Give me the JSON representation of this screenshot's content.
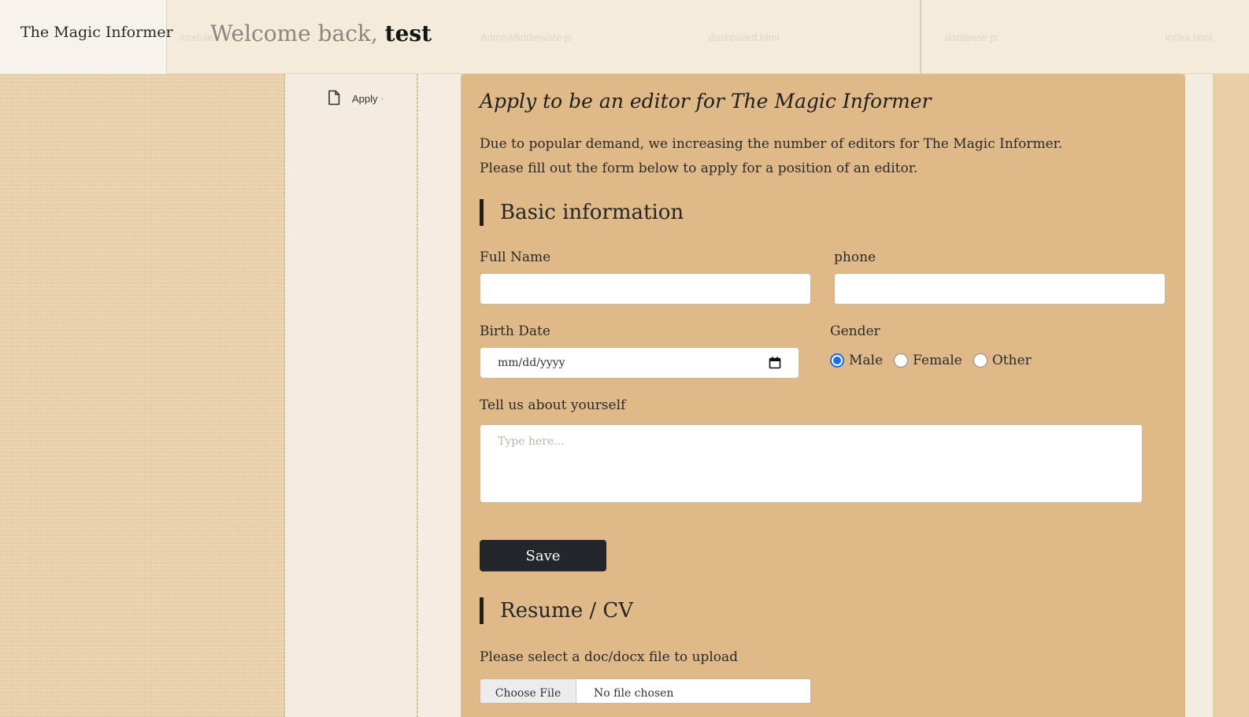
{
  "header": {
    "brand": "The Magic Informer",
    "welcome_prefix": "Welcome back,",
    "username": "test"
  },
  "sidebar": {
    "items": [
      {
        "label": "Apply",
        "icon": "document-icon"
      }
    ]
  },
  "form": {
    "title": "Apply to be an editor for The Magic Informer",
    "intro_line1": "Due to popular demand, we increasing the number of editors for The Magic Informer.",
    "intro_line2": "Please fill out the form below to apply for a position of an editor.",
    "basic_section": "Basic information",
    "full_name_label": "Full Name",
    "full_name_value": "",
    "phone_label": "phone",
    "phone_value": "",
    "birth_label": "Birth Date",
    "birth_placeholder": "mm/dd/yyyy",
    "gender_label": "Gender",
    "gender_options": [
      "Male",
      "Female",
      "Other"
    ],
    "gender_selected": "Male",
    "about_label": "Tell us about yourself",
    "about_placeholder": "Type here...",
    "save_label": "Save",
    "resume_section": "Resume / CV",
    "file_label": "Please select a doc/docx file to upload",
    "file_button": "Choose File",
    "file_status": "No file chosen"
  },
  "colors": {
    "card_bg": "#dfb988",
    "button_bg": "#23272b",
    "radio_accent": "#1a6fe3",
    "header_bg": "#f4ebdb"
  }
}
